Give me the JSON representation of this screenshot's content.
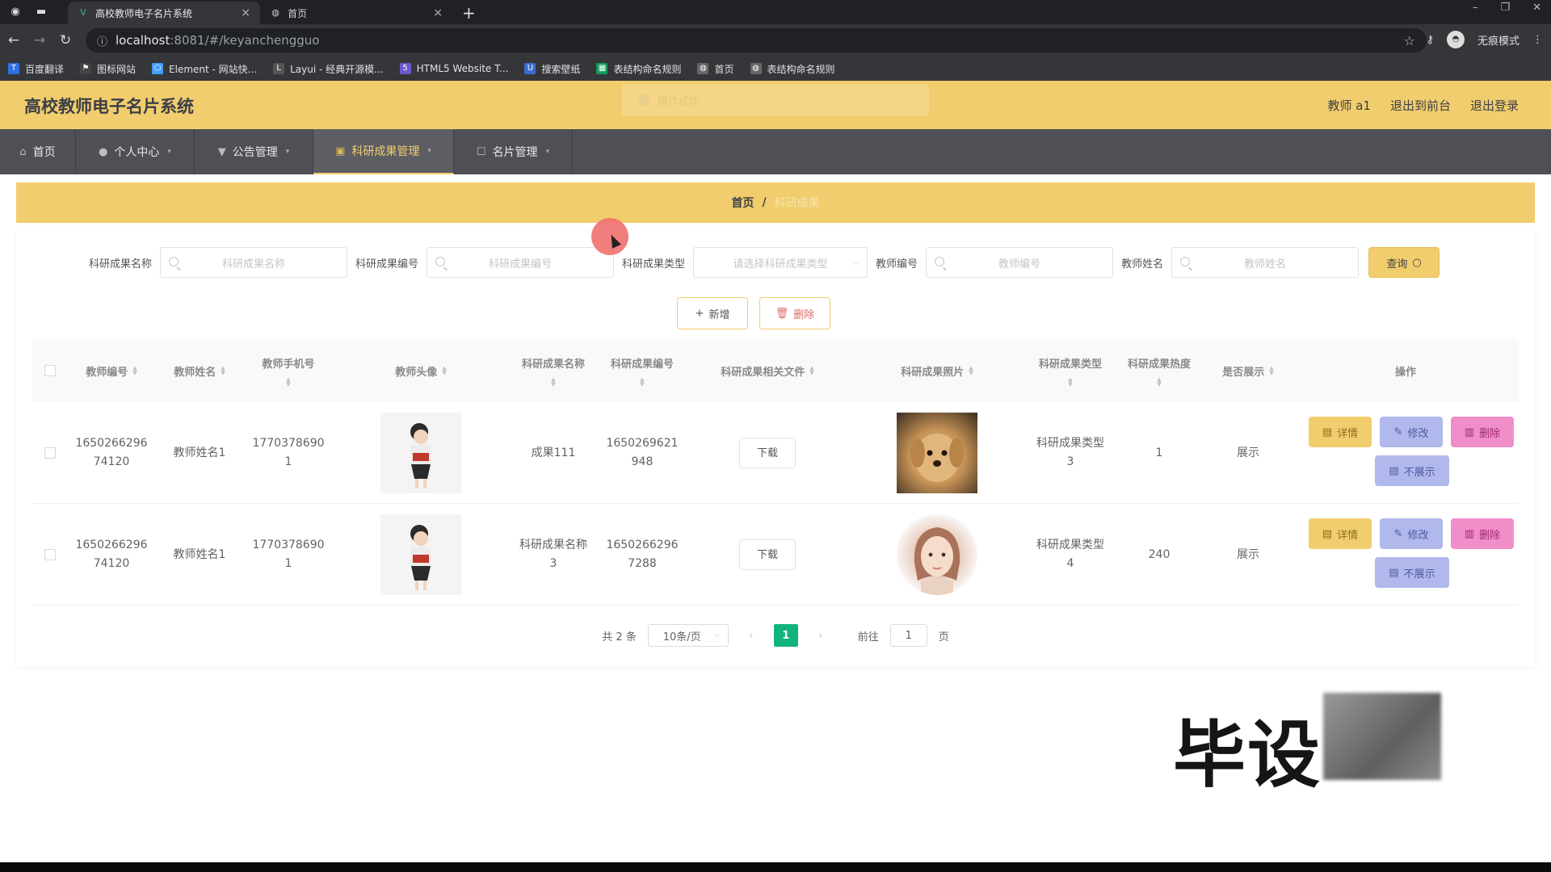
{
  "browser": {
    "tabs": [
      {
        "title": "高校教师电子名片系统",
        "active": true
      },
      {
        "title": "首页",
        "active": false
      }
    ],
    "url_host": "localhost",
    "url_rest": ":8081/#/keyanchengguo",
    "incognito_label": "无痕模式",
    "bookmarks": [
      {
        "label": "百度翻译",
        "icon": "translate-icon",
        "color": "#2f6fe4"
      },
      {
        "label": "图标网站",
        "icon": "flag-icon",
        "color": "#444444"
      },
      {
        "label": "Element - 网站快...",
        "icon": "element-icon",
        "color": "#409eff"
      },
      {
        "label": "Layui - 经典开源模...",
        "icon": "layui-icon",
        "color": "#555555"
      },
      {
        "label": "HTML5 Website T...",
        "icon": "html5-icon",
        "color": "#6a5acd"
      },
      {
        "label": "搜索壁纸",
        "icon": "wallpaper-icon",
        "color": "#3b6ccf"
      },
      {
        "label": "表结构命名规则",
        "icon": "sheet-icon",
        "color": "#0f9d58"
      },
      {
        "label": "首页",
        "icon": "globe-icon",
        "color": "#666666"
      },
      {
        "label": "表结构命名规则",
        "icon": "globe-icon",
        "color": "#666666"
      }
    ]
  },
  "header": {
    "title": "高校教师电子名片系统",
    "toast": "操作成功",
    "user": "教师 a1",
    "to_front": "退出到前台",
    "logout": "退出登录"
  },
  "menu": [
    {
      "label": "首页",
      "icon": "home-icon",
      "has_caret": false
    },
    {
      "label": "个人中心",
      "icon": "user-icon",
      "has_caret": true
    },
    {
      "label": "公告管理",
      "icon": "notice-icon",
      "has_caret": true
    },
    {
      "label": "科研成果管理",
      "icon": "research-icon",
      "has_caret": true,
      "active": true
    },
    {
      "label": "名片管理",
      "icon": "card-icon",
      "has_caret": true
    }
  ],
  "breadcrumb": {
    "home": "首页",
    "sep": "/",
    "current": "科研成果"
  },
  "search": {
    "name_label": "科研成果名称",
    "name_placeholder": "科研成果名称",
    "code_label": "科研成果编号",
    "code_placeholder": "科研成果编号",
    "type_label": "科研成果类型",
    "type_placeholder": "请选择科研成果类型",
    "teacher_no_label": "教师编号",
    "teacher_no_placeholder": "教师编号",
    "teacher_name_label": "教师姓名",
    "teacher_name_placeholder": "教师姓名",
    "query_label": "查询"
  },
  "actions": {
    "add_label": "新增",
    "delete_label": "删除"
  },
  "table": {
    "headers": {
      "teacher_no": "教师编号",
      "teacher_name": "教师姓名",
      "phone": "教师手机号",
      "avatar": "教师头像",
      "result_name": "科研成果名称",
      "result_code": "科研成果编号",
      "file": "科研成果相关文件",
      "photo": "科研成果照片",
      "type": "科研成果类型",
      "heat": "科研成果热度",
      "show": "是否展示",
      "ops": "操作"
    },
    "rows": [
      {
        "teacher_no_1": "1650266296",
        "teacher_no_2": "74120",
        "teacher_name": "教师姓名1",
        "phone_1": "1770378690",
        "phone_2": "1",
        "result_name_1": "成果111",
        "result_name_2": "",
        "result_code_1": "1650269621",
        "result_code_2": "948",
        "file_btn": "下载",
        "photo": "dog-photo",
        "type_1": "科研成果类型",
        "type_2": "3",
        "heat": "1",
        "show": "展示",
        "ops": {
          "detail": "详情",
          "edit": "修改",
          "delete": "删除",
          "hide": "不展示"
        }
      },
      {
        "teacher_no_1": "1650266296",
        "teacher_no_2": "74120",
        "teacher_name": "教师姓名1",
        "phone_1": "1770378690",
        "phone_2": "1",
        "result_name_1": "科研成果名称",
        "result_name_2": "3",
        "result_code_1": "1650266296",
        "result_code_2": "7288",
        "file_btn": "下载",
        "photo": "girl-photo",
        "type_1": "科研成果类型",
        "type_2": "4",
        "heat": "240",
        "show": "展示",
        "ops": {
          "detail": "详情",
          "edit": "修改",
          "delete": "删除",
          "hide": "不展示"
        }
      }
    ]
  },
  "pagination": {
    "total": "共 2 条",
    "page_size": "10条/页",
    "current": "1",
    "goto": "前往",
    "goto_value": "1",
    "page_unit": "页"
  },
  "watermark": "毕设"
}
